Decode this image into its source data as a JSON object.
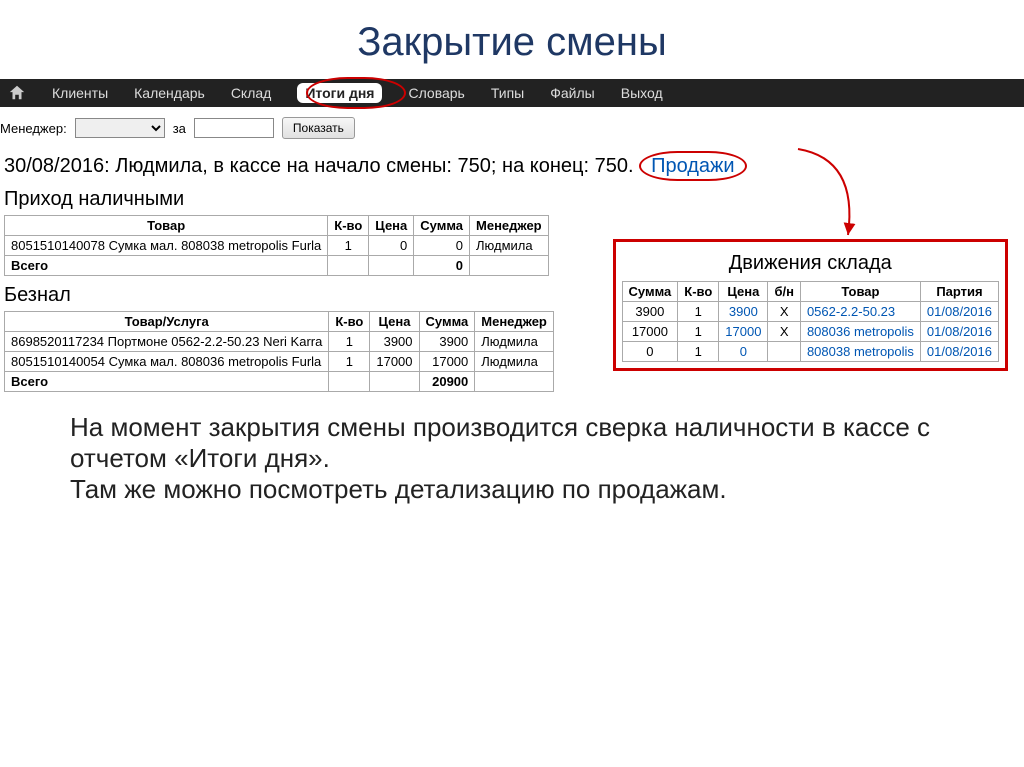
{
  "slide_title": "Закрытие смены",
  "nav": {
    "items": [
      "Клиенты",
      "Календарь",
      "Склад",
      "Итоги дня",
      "Словарь",
      "Типы",
      "Файлы",
      "Выход"
    ],
    "active_index": 3
  },
  "filter": {
    "manager_label": "Менеджер:",
    "za_label": "за",
    "show_btn": "Показать"
  },
  "status": {
    "text": "30/08/2016: Людмила, в кассе на начало смены: 750; на конец: 750.",
    "sales_link": "Продажи"
  },
  "cash": {
    "title": "Приход наличными",
    "headers": [
      "Товар",
      "К-во",
      "Цена",
      "Сумма",
      "Менеджер"
    ],
    "rows": [
      {
        "product": "8051510140078 Сумка мал. 808038 metropolis Furla",
        "qty": "1",
        "price": "0",
        "sum": "0",
        "manager": "Людмила"
      }
    ],
    "total_label": "Всего",
    "total_sum": "0"
  },
  "cashless": {
    "title": "Безнал",
    "headers": [
      "Товар/Услуга",
      "К-во",
      "Цена",
      "Сумма",
      "Менеджер"
    ],
    "rows": [
      {
        "product": "8698520117234 Портмоне 0562-2.2-50.23 Neri Karra",
        "qty": "1",
        "price": "3900",
        "sum": "3900",
        "manager": "Людмила"
      },
      {
        "product": "8051510140054 Сумка мал. 808036 metropolis Furla",
        "qty": "1",
        "price": "17000",
        "sum": "17000",
        "manager": "Людмила"
      }
    ],
    "total_label": "Всего",
    "total_sum": "20900"
  },
  "warehouse": {
    "title": "Движения склада",
    "headers": [
      "Сумма",
      "К-во",
      "Цена",
      "б/н",
      "Товар",
      "Партия"
    ],
    "rows": [
      {
        "sum": "3900",
        "qty": "1",
        "price": "3900",
        "bn": "X",
        "product": "0562-2.2-50.23",
        "batch": "01/08/2016"
      },
      {
        "sum": "17000",
        "qty": "1",
        "price": "17000",
        "bn": "X",
        "product": "808036 metropolis",
        "batch": "01/08/2016"
      },
      {
        "sum": "0",
        "qty": "1",
        "price": "0",
        "bn": "",
        "product": "808038 metropolis",
        "batch": "01/08/2016"
      }
    ]
  },
  "description": {
    "p1": "На момент закрытия смены производится сверка наличности в кассе с отчетом «Итоги дня».",
    "p2": "Там же можно посмотреть детализацию по продажам."
  }
}
